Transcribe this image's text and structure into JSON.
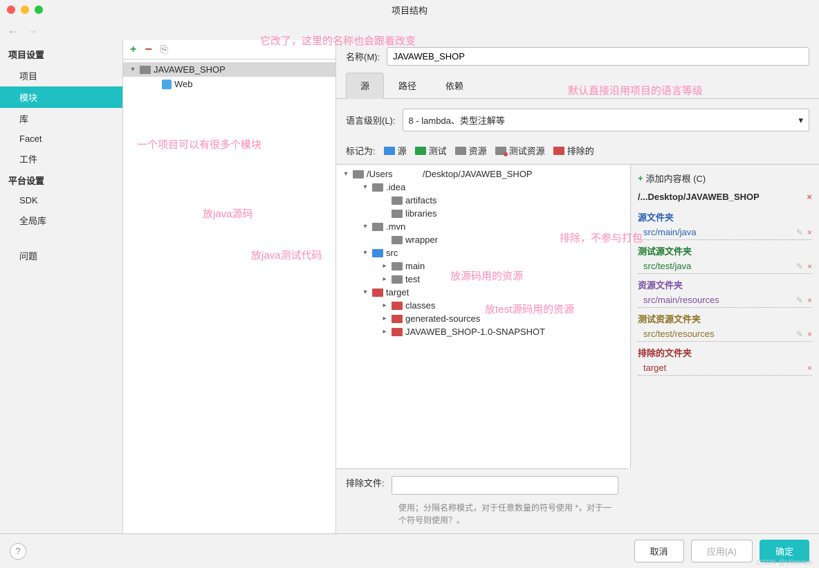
{
  "window": {
    "title": "项目结构"
  },
  "sidebar": {
    "headings": {
      "project": "项目设置",
      "platform": "平台设置"
    },
    "items": {
      "project": "项目",
      "modules": "模块",
      "libraries": "库",
      "facet": "Facet",
      "artifacts": "工件",
      "sdk": "SDK",
      "global_libs": "全局库",
      "problems": "问题"
    }
  },
  "module_tree": {
    "root": "JAVAWEB_SHOP",
    "children": [
      "Web"
    ]
  },
  "annotations": {
    "name_change": "它改了，这里的名称也会跟着改变",
    "many_modules": "一个项目可以有很多个模块",
    "java_src": "放java源码",
    "java_test": "放java测试代码",
    "src_res": "放源码用的资源",
    "test_res": "放test源码用的资源",
    "lang_default": "默认直接沿用项目的语言等级",
    "exclude_pkg": "排除，不参与打包"
  },
  "name_field": {
    "label": "名称(M):",
    "value": "JAVAWEB_SHOP"
  },
  "tabs": {
    "source": "源",
    "paths": "路径",
    "deps": "依赖"
  },
  "lang_level": {
    "label": "语言级别(L):",
    "value": "8 - lambda、类型注解等"
  },
  "mark_as": {
    "label": "标记为:",
    "source": "源",
    "test": "测试",
    "resource": "资源",
    "test_resource": "测试资源",
    "excluded": "排除的"
  },
  "folder_tree": {
    "root": "/Users            /Desktop/JAVAWEB_SHOP",
    "nodes": [
      {
        "label": ".idea",
        "indent": 1,
        "open": true,
        "color": ""
      },
      {
        "label": "artifacts",
        "indent": 2,
        "open": false,
        "color": ""
      },
      {
        "label": "libraries",
        "indent": 2,
        "open": false,
        "color": ""
      },
      {
        "label": ".mvn",
        "indent": 1,
        "open": true,
        "color": ""
      },
      {
        "label": "wrapper",
        "indent": 2,
        "open": false,
        "color": ""
      },
      {
        "label": "src",
        "indent": 1,
        "open": true,
        "color": "blue"
      },
      {
        "label": "main",
        "indent": 2,
        "open": false,
        "color": "",
        "arrow": true
      },
      {
        "label": "test",
        "indent": 2,
        "open": false,
        "color": "",
        "arrow": true
      },
      {
        "label": "target",
        "indent": 1,
        "open": true,
        "color": "red"
      },
      {
        "label": "classes",
        "indent": 2,
        "open": false,
        "color": "red",
        "arrow": true
      },
      {
        "label": "generated-sources",
        "indent": 2,
        "open": false,
        "color": "red",
        "arrow": true
      },
      {
        "label": "JAVAWEB_SHOP-1.0-SNAPSHOT",
        "indent": 2,
        "open": false,
        "color": "red",
        "arrow": true
      }
    ]
  },
  "roots": {
    "add_label": "添加内容根 (C)",
    "path": "/...Desktop/JAVAWEB_SHOP",
    "sections": [
      {
        "title": "源文件夹",
        "cls": "src",
        "items": [
          "src/main/java"
        ]
      },
      {
        "title": "测试源文件夹",
        "cls": "test",
        "items": [
          "src/test/java"
        ]
      },
      {
        "title": "资源文件夹",
        "cls": "res",
        "items": [
          "src/main/resources"
        ]
      },
      {
        "title": "测试资源文件夹",
        "cls": "testres",
        "items": [
          "src/test/resources"
        ]
      },
      {
        "title": "排除的文件夹",
        "cls": "excl",
        "items": [
          "target"
        ]
      }
    ]
  },
  "exclude": {
    "label": "排除文件:",
    "hint": "使用；分隔名称模式，对于任意数量的符号使用 *，对于一个符号则使用？。"
  },
  "footer": {
    "cancel": "取消",
    "apply": "应用(A)",
    "ok": "确定"
  }
}
